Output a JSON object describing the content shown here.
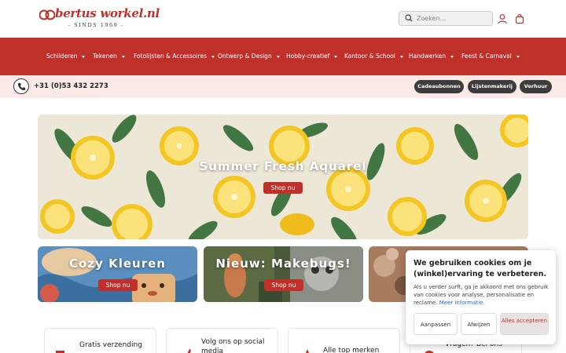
{
  "header": {
    "logo_name": "bertus workel.nl",
    "logo_tagline": "- SINDS 1969 -",
    "search_placeholder": "Zoeken...",
    "icons": [
      "search-icon",
      "account-icon",
      "cart-icon"
    ]
  },
  "nav": {
    "items": [
      {
        "label": "Schilderen"
      },
      {
        "label": "Tekenen"
      },
      {
        "label": "Fotolijsten & Accessoires"
      },
      {
        "label": "Ontwerp & Design"
      },
      {
        "label": "Hobby-creatief"
      },
      {
        "label": "Kantoor & School"
      },
      {
        "label": "Handwerken"
      },
      {
        "label": "Feest & Carnaval"
      }
    ]
  },
  "contact": {
    "phone": "+31 (0)53 432 2273",
    "buttons": [
      "Cadeaubonnen",
      "Lijstenmakerij",
      "Verhuur"
    ]
  },
  "hero": {
    "title": "Summer Fresh Aquarel",
    "button": "Shop nu"
  },
  "cards": [
    {
      "title": "Cozy Kleuren",
      "button": "Shop nu"
    },
    {
      "title": "Nieuw: Makebugs!",
      "button": "Shop nu"
    }
  ],
  "features": [
    {
      "label": "Gratis verzending"
    },
    {
      "label_line1": "Volg ons op social",
      "label_line2": "media"
    },
    {
      "label": "Alle top merken"
    },
    {
      "label": "Vragen? Bel ons"
    }
  ],
  "cookie": {
    "title": "We gebruiken cookies om je (winkel)ervaring te verbeteren.",
    "text": "Als u verder surft, ga je akkoord met ons gebruik van cookies voor analyse, personalisatie en reclame.",
    "link": "Meer informatie.",
    "buttons": {
      "customize": "Aanpassen",
      "reject": "Afwijzen",
      "accept": "Alles accepteren"
    }
  },
  "colors": {
    "brand_red": "#c0302b",
    "contact_bg": "#fbe9e8",
    "pill_dark": "#3c3c3c"
  }
}
